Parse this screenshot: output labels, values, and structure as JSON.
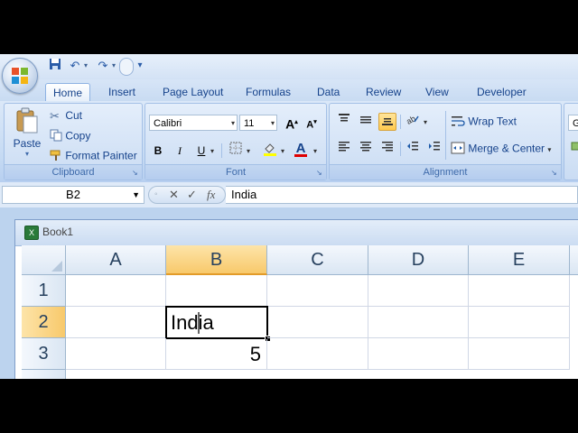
{
  "qat": {
    "customize_label": "▾"
  },
  "tabs": [
    {
      "label": "Home",
      "active": true
    },
    {
      "label": "Insert"
    },
    {
      "label": "Page Layout"
    },
    {
      "label": "Formulas"
    },
    {
      "label": "Data"
    },
    {
      "label": "Review"
    },
    {
      "label": "View"
    },
    {
      "label": "Developer"
    }
  ],
  "clipboard": {
    "paste_label": "Paste",
    "cut_label": "Cut",
    "copy_label": "Copy",
    "format_painter_label": "Format Painter",
    "group_label": "Clipboard"
  },
  "font": {
    "font_name": "Calibri",
    "font_size": "11",
    "bold": "B",
    "italic": "I",
    "underline": "U",
    "font_color_glyph": "A",
    "group_label": "Font"
  },
  "alignment": {
    "wrap_text_label": "Wrap Text",
    "merge_center_label": "Merge & Center",
    "group_label": "Alignment"
  },
  "number_group_partial": "G",
  "formula_bar": {
    "name_box": "B2",
    "fx_label": "fx",
    "cancel_glyph": "✕",
    "enter_glyph": "✓",
    "content": "India"
  },
  "workbook": {
    "title": "Book1",
    "columns": [
      "A",
      "B",
      "C",
      "D",
      "E"
    ],
    "selected_column": "B",
    "rows": [
      "1",
      "2",
      "3"
    ],
    "selected_row": "2",
    "cells": {
      "B2": "India",
      "B3": "5"
    }
  },
  "colors": {
    "accent": "#15428b",
    "selected_header": "#f8c96b"
  }
}
